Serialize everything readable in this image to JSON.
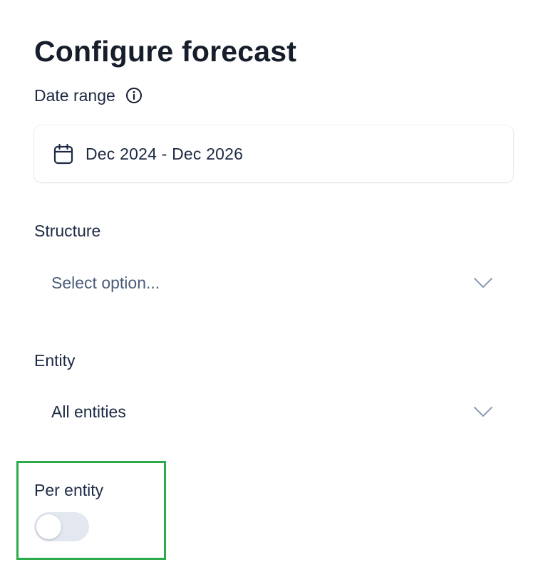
{
  "page": {
    "title": "Configure forecast"
  },
  "date_range": {
    "label": "Date range",
    "value": "Dec 2024 - Dec 2026"
  },
  "structure": {
    "label": "Structure",
    "placeholder": "Select option..."
  },
  "entity": {
    "label": "Entity",
    "value": "All entities"
  },
  "per_entity": {
    "label": "Per entity",
    "enabled": false
  },
  "icons": {
    "info": "info-circle-icon",
    "calendar": "calendar-icon",
    "dropdown": "chevron-down-icon"
  },
  "colors": {
    "highlight_border": "#2cab4b",
    "toggle_off_track": "#e3e8f0",
    "text_primary": "#1d2a44",
    "placeholder_text": "#4a5d78",
    "chevron": "#8a9bb5"
  }
}
